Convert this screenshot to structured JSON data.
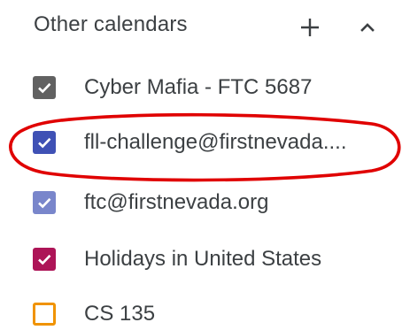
{
  "section": {
    "title": "Other calendars",
    "add_icon": "plus-icon",
    "collapse_icon": "chevron-up-icon"
  },
  "calendars": [
    {
      "label": "Cyber Mafia - FTC 5687",
      "checked": true,
      "color": "#616161"
    },
    {
      "label": "fll-challenge@firstnevada....",
      "checked": true,
      "color": "#3f51b5"
    },
    {
      "label": "ftc@firstnevada.org",
      "checked": true,
      "color": "#7986cb"
    },
    {
      "label": "Holidays in United States",
      "checked": true,
      "color": "#ad1457"
    },
    {
      "label": "CS 135",
      "checked": false,
      "color": "#f09300"
    }
  ],
  "annotation": {
    "color": "#e00000"
  }
}
